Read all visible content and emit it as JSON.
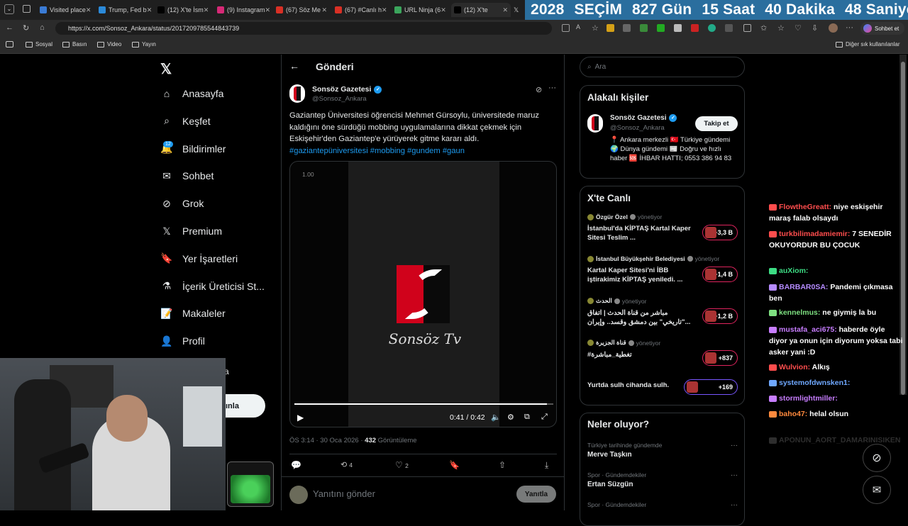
{
  "browser": {
    "tabs": [
      {
        "label": "Visited place",
        "color": "#3a7bd5"
      },
      {
        "label": "Trump, Fed b",
        "color": "#2b8ad9"
      },
      {
        "label": "(12) X'te İsm",
        "color": "#000000"
      },
      {
        "label": "(9) Instagram",
        "color": "#d62976"
      },
      {
        "label": "(67) Söz Me",
        "color": "#d93025"
      },
      {
        "label": "(67) #Canlı h",
        "color": "#d93025"
      },
      {
        "label": "URL Ninja (6",
        "color": "#3ba55c"
      },
      {
        "label": "(12) X'te",
        "color": "#000000"
      }
    ],
    "url": "https://x.com/Sonsoz_Ankara/status/2017209785544843739",
    "bookmarks": [
      "Sosyal",
      "Basın",
      "Video",
      "Yayın"
    ],
    "other_bookmarks": "Diğer sık kullanılanlar",
    "chat_button": "Sohbet et"
  },
  "countdown": {
    "year": "2028",
    "label": "SEÇİM",
    "days": "827 Gün",
    "hours": "15 Saat",
    "minutes": "40 Dakika",
    "seconds": "48 Saniye",
    "bg": "#2a6e9e"
  },
  "nav": {
    "items": [
      {
        "label": "Anasayfa",
        "icon": "home-icon"
      },
      {
        "label": "Keşfet",
        "icon": "search-icon"
      },
      {
        "label": "Bildirimler",
        "icon": "bell-icon"
      },
      {
        "label": "Sohbet",
        "icon": "mail-icon"
      },
      {
        "label": "Grok",
        "icon": "grok-icon"
      },
      {
        "label": "Premium",
        "icon": "x-icon"
      },
      {
        "label": "Yer İşaretleri",
        "icon": "bookmark-icon"
      },
      {
        "label": "İçerik Üreticisi St...",
        "icon": "flask-icon"
      },
      {
        "label": "Makaleler",
        "icon": "article-icon"
      },
      {
        "label": "Profil",
        "icon": "person-icon"
      }
    ],
    "notification_count": "12",
    "post_button_partial": "ınla",
    "partial_text": "a"
  },
  "post": {
    "header_title": "Gönderi",
    "author_name": "Sonsöz Gazetesi",
    "author_handle": "@Sonsoz_Ankara",
    "text": "Gaziantep Üniversitesi öğrencisi Mehmet Gürsoylu, üniversitede maruz kaldığını öne sürdüğü mobbing uygulamalarına dikkat çekmek için Eskişehir'den Gaziantep'e yürüyerek gitme kararı aldı.",
    "hashtags": "#gaziantepüniversitesi #mobbing #gundem #gaun",
    "video": {
      "speed": "1.00",
      "logo_text": "Sonsöz Tv",
      "time": "0:41 / 0:42",
      "progress": 0.976
    },
    "meta_time": "ÖS 3:14 · 30 Oca 2026 · ",
    "views_count": "432",
    "views_label": " Görüntüleme",
    "retweets": "4",
    "likes": "2",
    "reply_placeholder": "Yanıtını gönder",
    "reply_button": "Yanıtla"
  },
  "sidebar": {
    "search_placeholder": "Ara",
    "related_title": "Alakalı kişiler",
    "related_person": {
      "name": "Sonsöz Gazetesi",
      "handle": "@Sonsoz_Ankara",
      "follow": "Takip et",
      "bio": "📍 Ankara merkezli 🇹🇷 Türkiye gündemi 🌍 Dünya gündemi 📰 Doğru ve hızlı haber 🆘 İHBAR HATTI; 0553 386 94 83"
    },
    "live_title": "X'te Canlı",
    "live": [
      {
        "host": "Özgür Özel",
        "role": "yönetiyor",
        "title": "İstanbul'da KİPTAŞ Kartal Kaper Sitesi Teslim ...",
        "count": "+3,3 B"
      },
      {
        "host": "İstanbul Büyükşehir Belediyesi",
        "role": "yönetiyor",
        "title": "Kartal Kaper Sitesi'ni İBB iştirakimiz KİPTAŞ yeniledi. ...",
        "count": "+1,4 B"
      },
      {
        "host": "الحدث",
        "role": "yönetiyor",
        "title": "مباشر من قناة الحدث | اتفاق \"تاريخي\" بين دمشق وقسد.. وإيران...",
        "count": "+1,2 B"
      },
      {
        "host": "قناة الجزيرة",
        "role": "yönetiyor",
        "title": "#تغطية_مباشرة",
        "count": "+837"
      },
      {
        "host": "",
        "role": "",
        "title": "Yurtda sulh cihanda sulh.",
        "count": "+169"
      }
    ],
    "trends_title": "Neler oluyor?",
    "trends": [
      {
        "context": "Türkiye tarihinde gündemde",
        "name": "Merve Taşkın"
      },
      {
        "context": "Spor · Gündemdekiler",
        "name": "Ertan Süzgün"
      },
      {
        "context": "Spor · Gündemdekiler",
        "name": ""
      }
    ]
  },
  "chat": [
    {
      "user": "FlowtheGreatt:",
      "msg": " niye eskişehir maraş falab olsaydı",
      "color": "#ff4d4d"
    },
    {
      "user": "turkbilimadamiemir:",
      "msg": " 7 SENEDİR OKUYORDUR BU ÇOCUK",
      "color": "#ff4d4d"
    },
    {
      "user": "auXiom:",
      "msg": "",
      "color": "#3ddc84"
    },
    {
      "user": "BARBAR0SA:",
      "msg": " Pandemi çıkmasa ben",
      "color": "#b58bff"
    },
    {
      "user": "kennelmus:",
      "msg": " ne giymiş la bu",
      "color": "#7ee081"
    },
    {
      "user": "mustafa_aci675:",
      "msg": " haberde öyle diyor ya onun için diyorum yoksa tabi asker yani :D",
      "color": "#c77dff"
    },
    {
      "user": "Wulvion:",
      "msg": " Alkış",
      "color": "#ff4d4d"
    },
    {
      "user": "systemofdwnsken1:",
      "msg": "",
      "color": "#6fa8ff"
    },
    {
      "user": "stormlightmiller:",
      "msg": "",
      "color": "#c77dff"
    },
    {
      "user": "baho47:",
      "msg": " helal olsun",
      "color": "#ff8a3d"
    },
    {
      "user": "APONUN_AORT_DAMARINISIKEN",
      "msg": "",
      "color": "#666666"
    }
  ]
}
